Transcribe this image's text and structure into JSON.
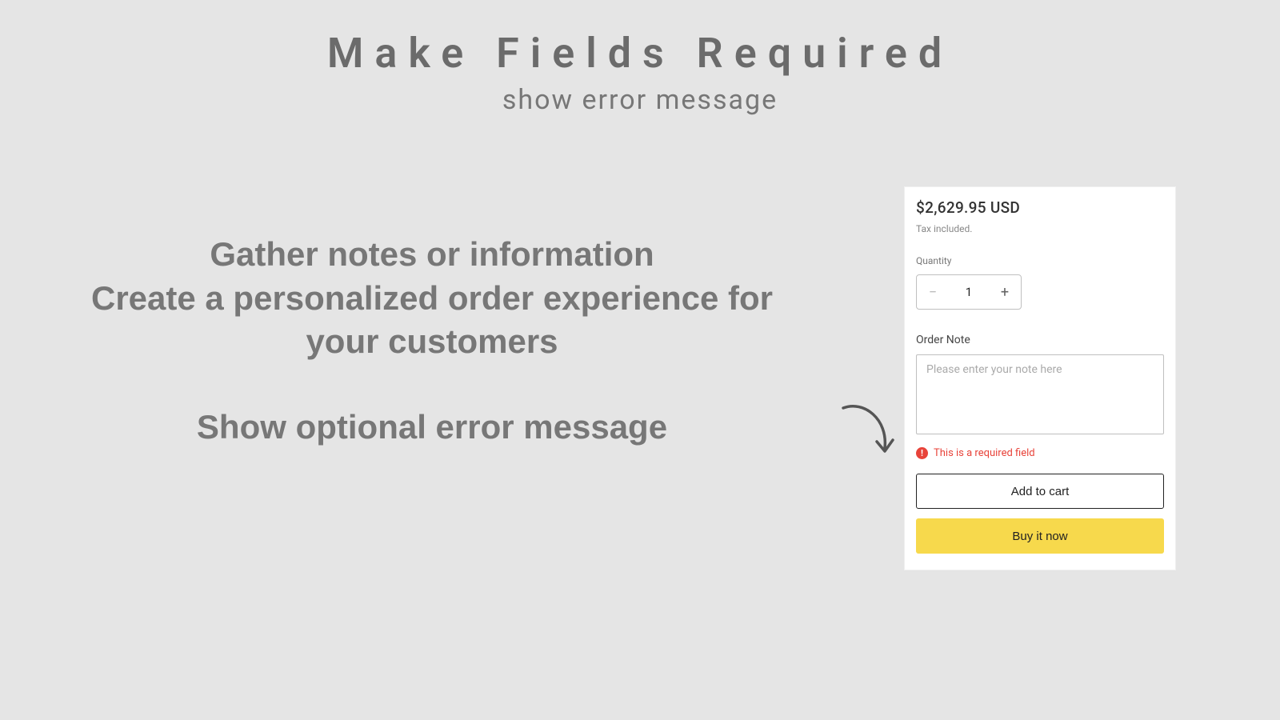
{
  "page": {
    "title": "Make Fields Required",
    "subtitle": "show error message"
  },
  "marketing": {
    "line1": "Gather notes or information",
    "line2": "Create a personalized order experience for your customers",
    "line3": "Show optional error message"
  },
  "card": {
    "price": "$2,629.95 USD",
    "tax_note": "Tax included.",
    "quantity_label": "Quantity",
    "quantity_value": "1",
    "btn_minus": "−",
    "btn_plus": "+",
    "order_note_label": "Order Note",
    "order_note_placeholder": "Please enter your note here",
    "error_glyph": "!",
    "error_message": "This is a required field",
    "add_to_cart": "Add to cart",
    "buy_now": "Buy it now"
  }
}
